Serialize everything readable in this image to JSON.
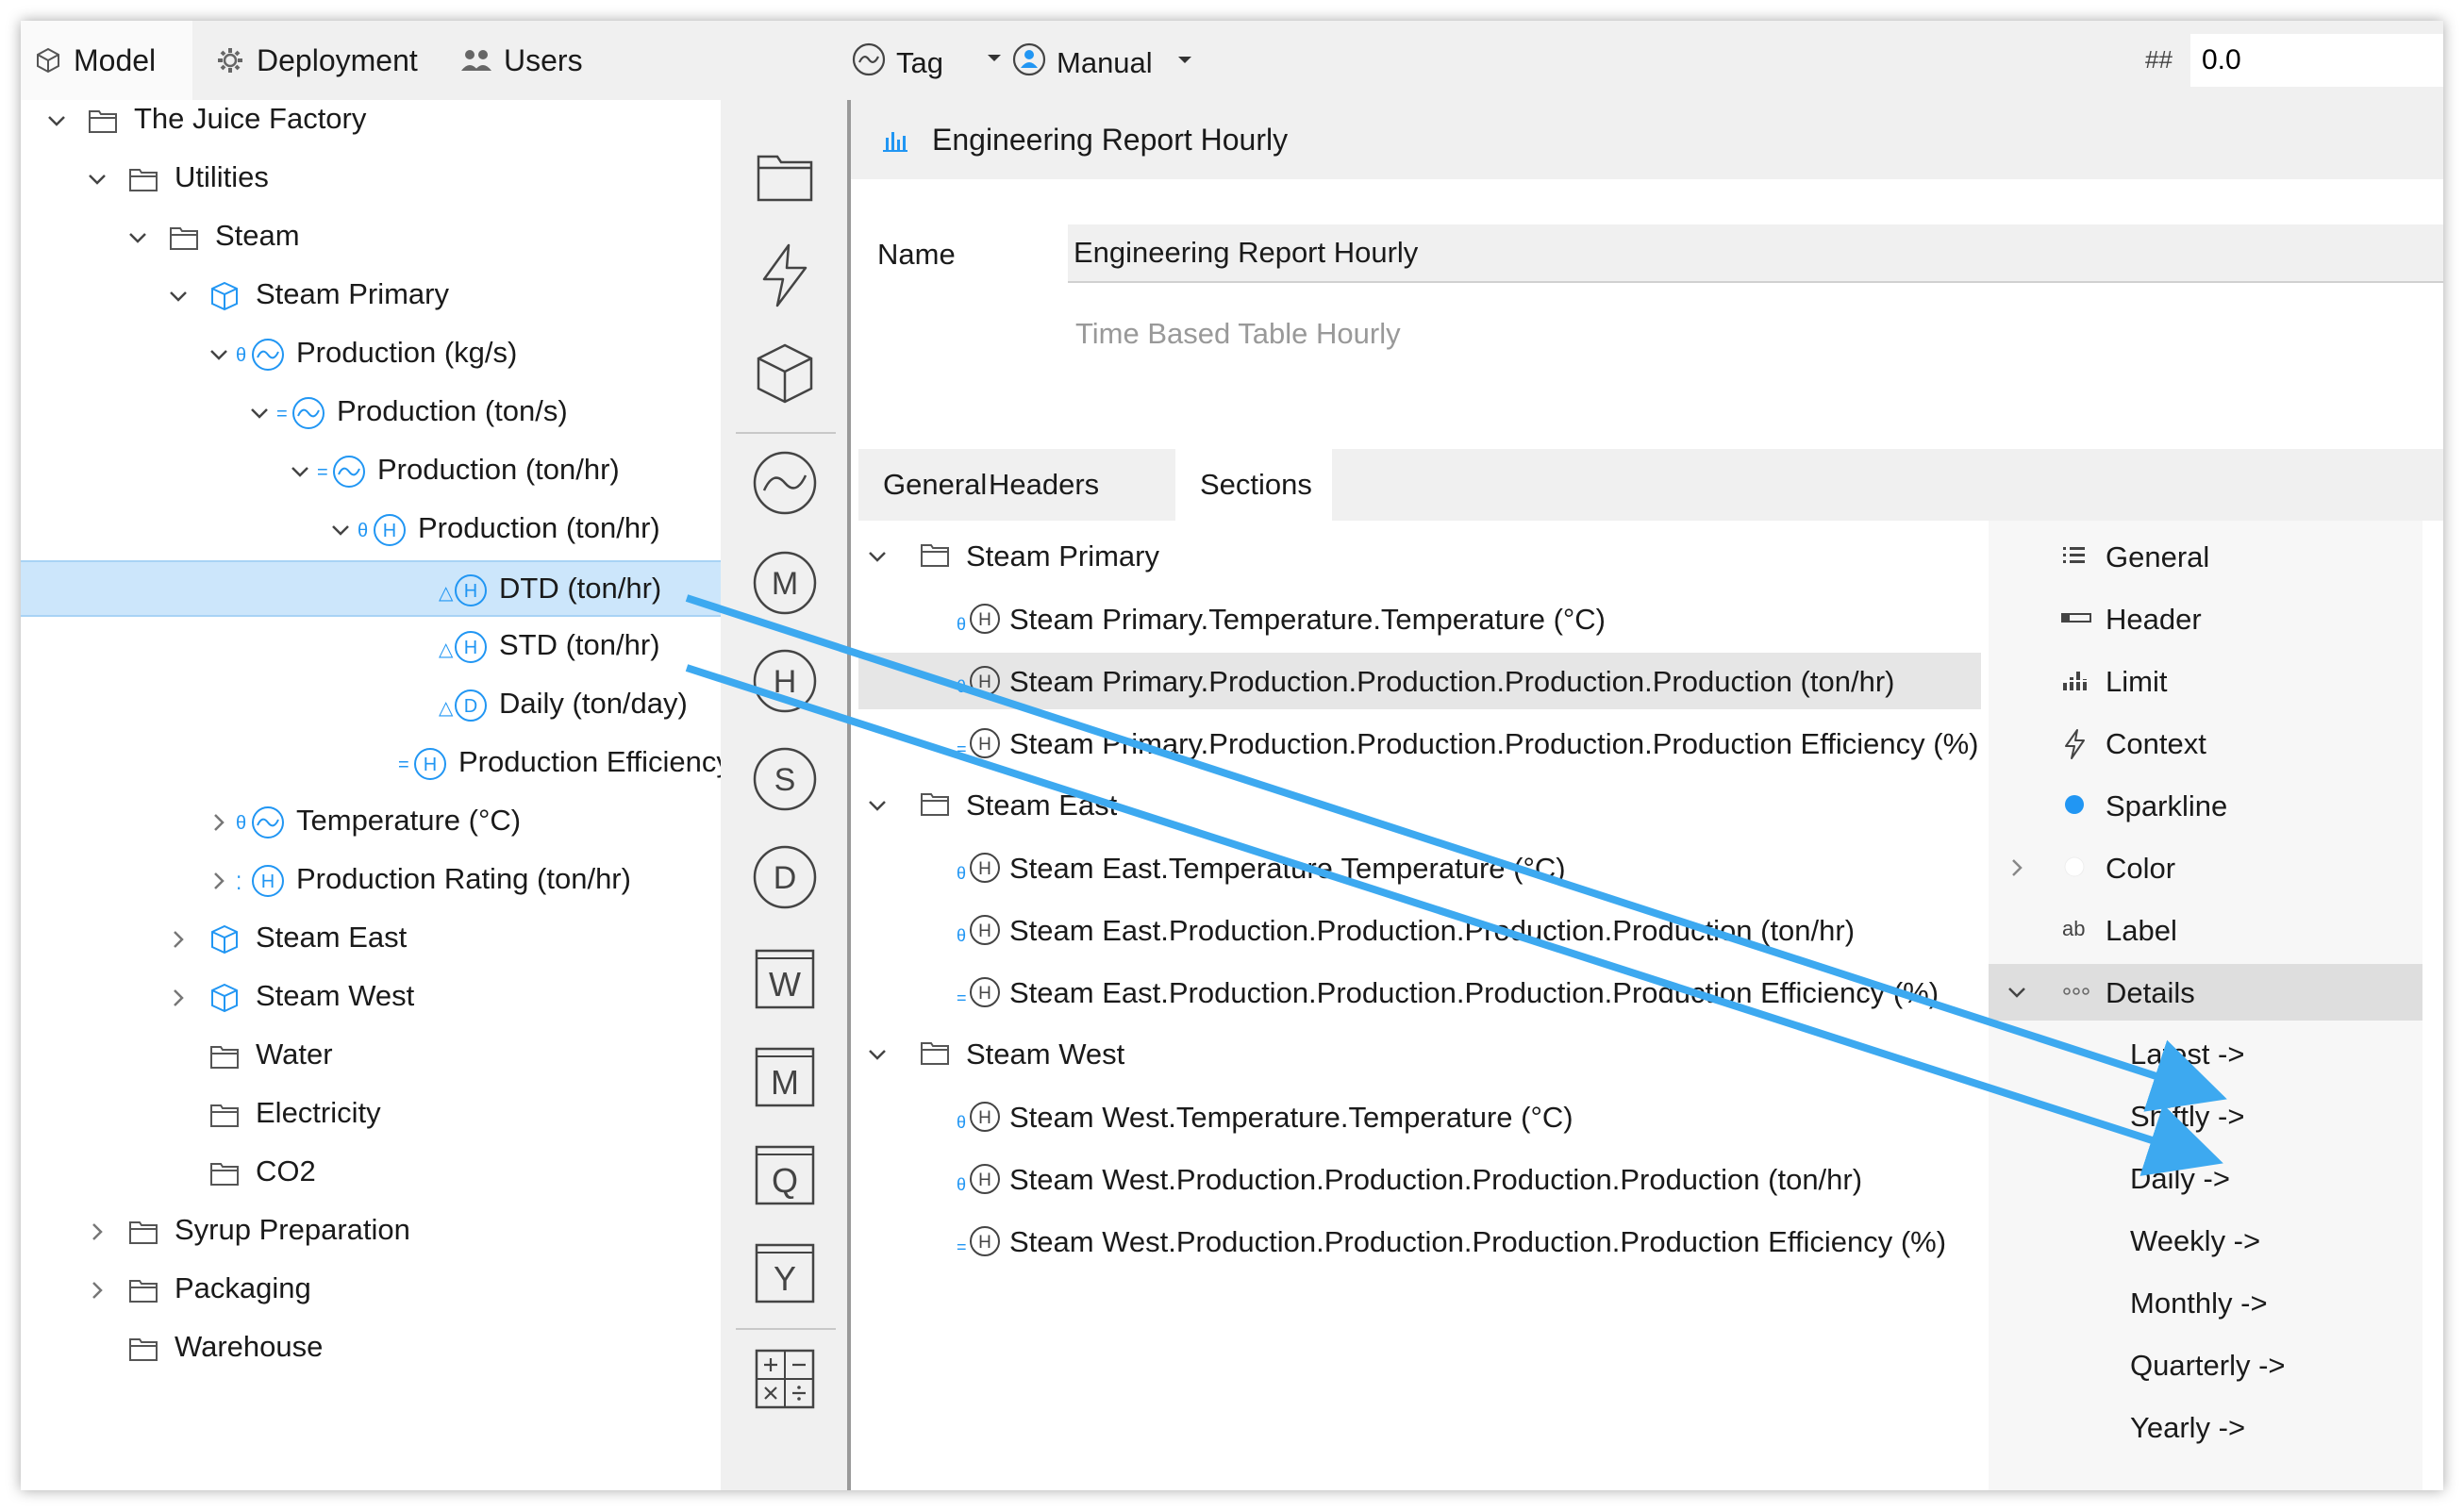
{
  "topbar": {
    "tabs": [
      {
        "label": "Model",
        "icon": "cube-icon"
      },
      {
        "label": "Deployment",
        "icon": "gear-icon"
      },
      {
        "label": "Users",
        "icon": "users-icon"
      }
    ],
    "tag_label": "Tag",
    "mode_label": "Manual",
    "number_prefix": "##",
    "number_value": "0.0"
  },
  "tree": [
    {
      "label": "The Juice Factory",
      "badge": ""
    },
    {
      "label": "Utilities",
      "badge": ""
    },
    {
      "label": "Steam",
      "badge": ""
    },
    {
      "label": "Steam Primary",
      "badge": ""
    },
    {
      "label": "Production (kg/s)",
      "badge": "θ"
    },
    {
      "label": "Production (ton/s)",
      "badge": "="
    },
    {
      "label": "Production (ton/hr)",
      "badge": "="
    },
    {
      "label": "Production (ton/hr)",
      "badge": "θ"
    },
    {
      "label": "DTD (ton/hr)",
      "badge": "△"
    },
    {
      "label": "STD (ton/hr)",
      "badge": "△"
    },
    {
      "label": "Daily (ton/day)",
      "badge": "△"
    },
    {
      "label": "Production Efficiency (%",
      "badge": "="
    },
    {
      "label": "Temperature (°C)",
      "badge": "θ"
    },
    {
      "label": "Production Rating (ton/hr)",
      "badge": "⁚"
    },
    {
      "label": "Steam East",
      "badge": ""
    },
    {
      "label": "Steam West",
      "badge": ""
    },
    {
      "label": "Water",
      "badge": ""
    },
    {
      "label": "Electricity",
      "badge": ""
    },
    {
      "label": "CO2",
      "badge": ""
    },
    {
      "label": "Syrup Preparation",
      "badge": ""
    },
    {
      "label": "Packaging",
      "badge": ""
    },
    {
      "label": "Warehouse",
      "badge": ""
    }
  ],
  "palette": {
    "circle_letters": [
      "M",
      "H",
      "S",
      "D"
    ],
    "box_letters": [
      "W",
      "M",
      "Q",
      "Y"
    ]
  },
  "main": {
    "title": "Engineering Report Hourly",
    "name_label": "Name",
    "name_value": "Engineering Report Hourly",
    "subtitle": "Time Based Table Hourly",
    "tabs": [
      "General",
      "Headers",
      "Sections"
    ],
    "sections": [
      {
        "label": "Steam Primary",
        "items": [
          {
            "label": "Steam Primary.Temperature.Temperature (°C)",
            "badge": "θ"
          },
          {
            "label": "Steam Primary.Production.Production.Production.Production (ton/hr)",
            "badge": "θ"
          },
          {
            "label": "Steam Primary.Production.Production.Production.Production Efficiency (%)",
            "badge": "="
          }
        ]
      },
      {
        "label": "Steam East",
        "items": [
          {
            "label": "Steam East.Temperature.Temperature (°C)",
            "badge": "θ"
          },
          {
            "label": "Steam East.Production.Production.Production.Production (ton/hr)",
            "badge": "θ"
          },
          {
            "label": "Steam East.Production.Production.Production.Production Efficiency (%)",
            "badge": "="
          }
        ]
      },
      {
        "label": "Steam West",
        "items": [
          {
            "label": "Steam West.Temperature.Temperature (°C)",
            "badge": "θ"
          },
          {
            "label": "Steam West.Production.Production.Production.Production (ton/hr)",
            "badge": "θ"
          },
          {
            "label": "Steam West.Production.Production.Production.Production Efficiency (%)",
            "badge": "="
          }
        ]
      }
    ],
    "properties": [
      {
        "label": "General",
        "icon": "list-icon"
      },
      {
        "label": "Header",
        "icon": "header-icon"
      },
      {
        "label": "Limit",
        "icon": "limit-icon"
      },
      {
        "label": "Context",
        "icon": "bolt-icon"
      },
      {
        "label": "Sparkline",
        "icon": "dot-icon"
      },
      {
        "label": "Color",
        "icon": "color-icon"
      },
      {
        "label": "Label",
        "icon": "label-icon"
      },
      {
        "label": "Details",
        "icon": "dots-icon"
      }
    ],
    "details": [
      "Latest ->",
      "Shiftly ->",
      "Daily ->",
      "Weekly ->",
      "Monthly ->",
      "Quarterly ->",
      "Yearly ->"
    ]
  },
  "colors": {
    "accent": "#2196f3",
    "selection": "#cce6fb",
    "arrow": "#3da9f0"
  }
}
